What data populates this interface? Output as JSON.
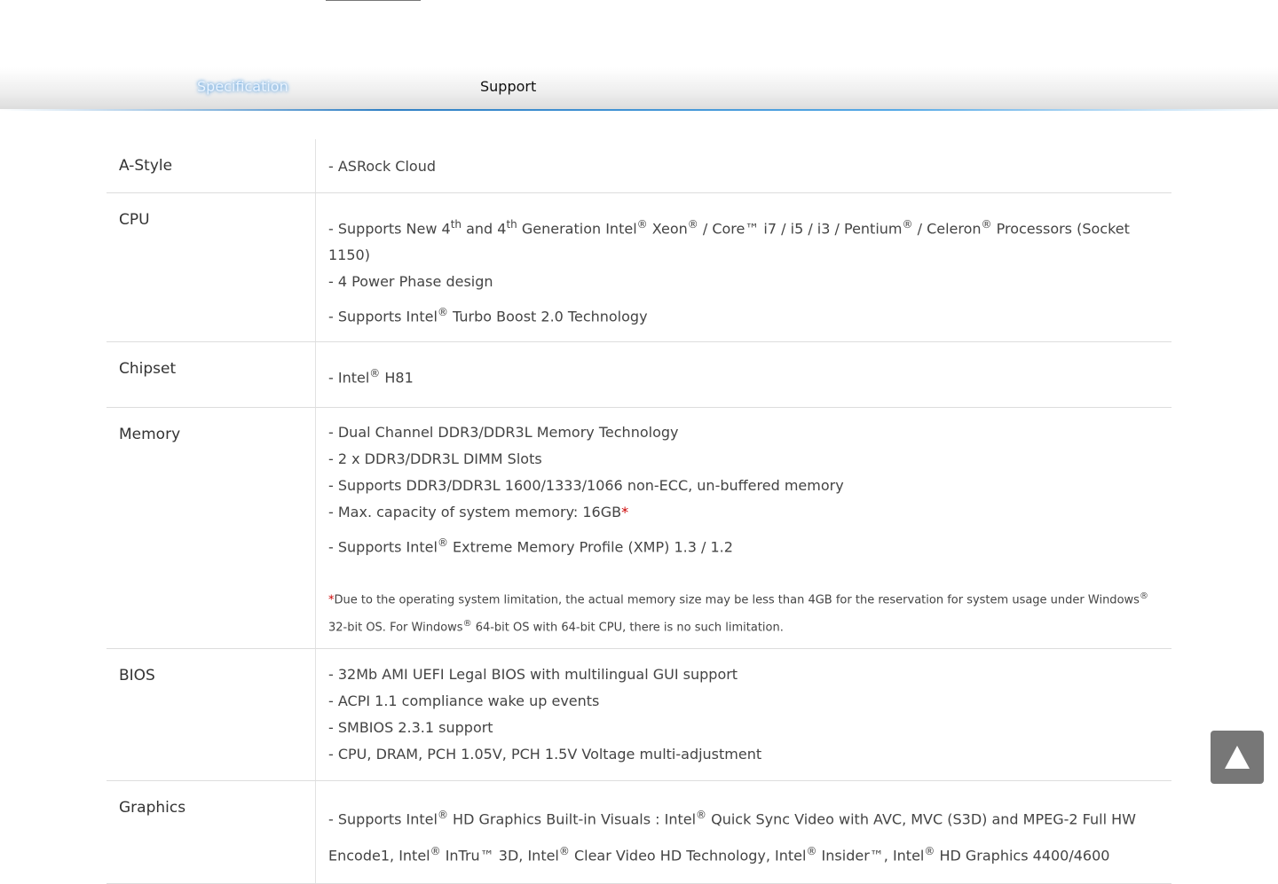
{
  "tabs": {
    "specification": "Specification",
    "support": "Support"
  },
  "specs": {
    "astyle": {
      "label": "A-Style",
      "line1": "- ASRock Cloud"
    },
    "cpu": {
      "label": "CPU",
      "line1_a": "- Supports New 4",
      "line1_th1": "th",
      "line1_b": " and 4",
      "line1_th2": "th",
      "line1_c": " Generation Intel",
      "line1_d": " Xeon",
      "line1_e": " / Core™ i7 / i5 / i3 / Pentium",
      "line1_f": " / Celeron",
      "line1_g": " Processors (Socket 1150)",
      "line2": "- 4 Power Phase design",
      "line3_a": "- Supports Intel",
      "line3_b": " Turbo Boost 2.0 Technology"
    },
    "chipset": {
      "label": "Chipset",
      "line1_a": "- Intel",
      "line1_b": " H81"
    },
    "memory": {
      "label": "Memory",
      "line1": "- Dual Channel DDR3/DDR3L Memory Technology",
      "line2": "- 2 x DDR3/DDR3L DIMM Slots",
      "line3": "- Supports DDR3/DDR3L 1600/1333/1066 non-ECC, un-buffered memory",
      "line4": "- Max. capacity of system memory: 16GB",
      "line5_a": "- Supports Intel",
      "line5_b": " Extreme Memory Profile (XMP) 1.3 / 1.2",
      "note_a": "Due to the operating system limitation, the actual memory size may be less than 4GB for the reservation for system usage under Windows",
      "note_b": " 32-bit OS. For Windows",
      "note_c": " 64-bit OS with 64-bit CPU, there is no such limitation."
    },
    "bios": {
      "label": "BIOS",
      "line1": "- 32Mb AMI UEFI Legal BIOS with multilingual GUI support",
      "line2": "- ACPI 1.1 compliance wake up events",
      "line3": "- SMBIOS 2.3.1 support",
      "line4": "- CPU, DRAM, PCH 1.05V, PCH 1.5V Voltage multi-adjustment"
    },
    "graphics": {
      "label": "Graphics",
      "line1_a": "- Supports Intel",
      "line1_b": " HD Graphics Built-in Visuals : Intel",
      "line1_c": " Quick Sync Video with AVC, MVC (S3D) and MPEG-2 Full HW Encode1, Intel",
      "line1_d": " InTru™ 3D, Intel",
      "line1_e": " Clear Video HD Technology, Intel",
      "line1_f": " Insider™, Intel",
      "line1_g": " HD Graphics 4400/4600"
    }
  },
  "symbols": {
    "registered": "®",
    "asterisk": "*"
  },
  "icons": {
    "back_to_top": "triangle-up-icon"
  },
  "colors": {
    "accent_line": "#2f7fc4",
    "asterisk": "#cc0000",
    "back_to_top_bg": "#777777"
  }
}
